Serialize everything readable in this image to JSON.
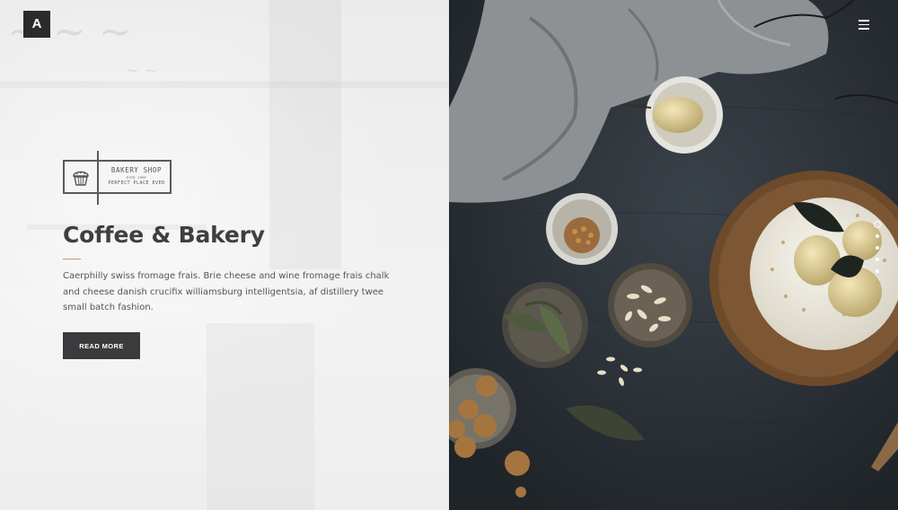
{
  "logo": {
    "letter": "A"
  },
  "badge": {
    "title": "BAKERY SHOP",
    "est": "ESTD 1999",
    "subtitle": "PERFECT PLACE EVER",
    "icon": "cupcake-icon"
  },
  "hero": {
    "title": "Coffee & Bakery",
    "description": "Caerphilly swiss fromage frais. Brie cheese and wine fromage frais chalk and cheese danish crucifix williamsburg intelligentsia, af distillery twee small batch fashion.",
    "button_label": "READ MORE"
  },
  "menu": {
    "icon": "hamburger-menu-icon"
  },
  "slider": {
    "count": 5,
    "active_index": 0
  },
  "colors": {
    "accent": "#b89a72",
    "dark": "#3b3b3d",
    "photo_bg": "#2c3237"
  }
}
